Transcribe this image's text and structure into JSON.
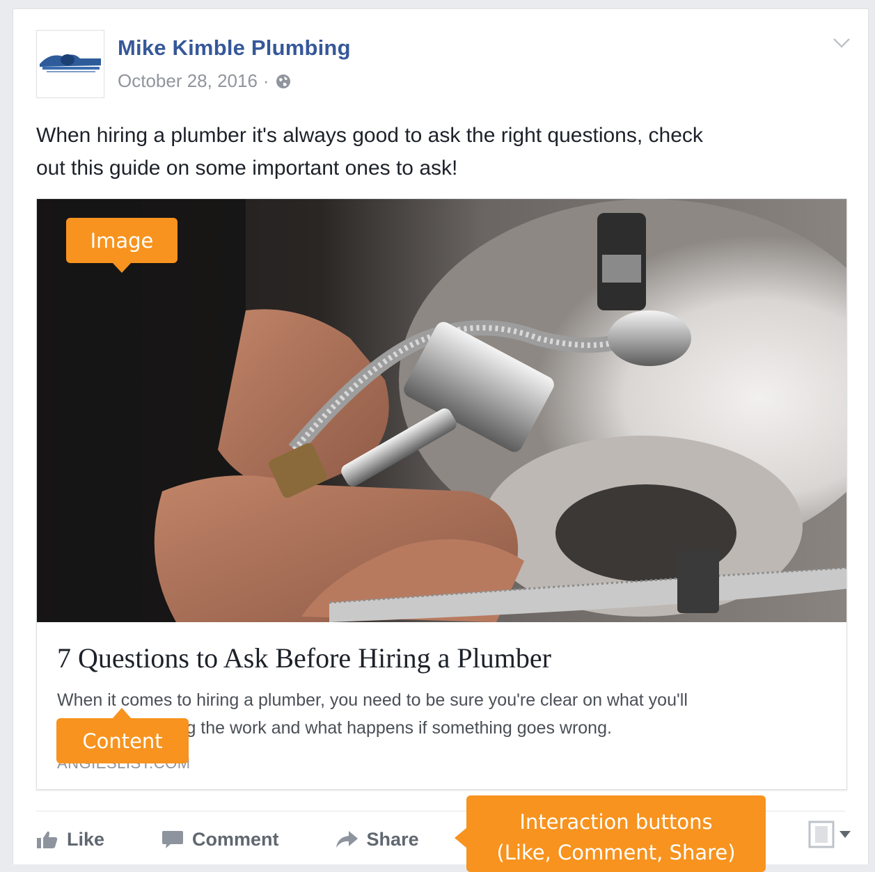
{
  "post": {
    "page_name": "Mike Kimble Plumbing",
    "date": "October 28, 2016",
    "separator": "·",
    "text_line1": "When hiring a plumber it's always good to ask the right questions, check",
    "text_line2": "out this guide on some important ones to ask!"
  },
  "link": {
    "title": "7 Questions to Ask Before Hiring a Plumber",
    "description_line1": "When it comes to hiring a plumber, you need to be sure you're clear on what you'll",
    "description_line2": "have, who's doing the work and what happens if something goes wrong.",
    "source": "ANGIESLIST.COM"
  },
  "actions": {
    "like": "Like",
    "comment": "Comment",
    "share": "Share"
  },
  "annotations": {
    "image": "Image",
    "content": "Content",
    "interaction_line1": "Interaction buttons",
    "interaction_line2": "(Like, Comment, Share)"
  },
  "icons": {
    "avatar": "company-logo",
    "meta": "globe-icon",
    "menu": "chevron-down-icon",
    "like": "thumbs-up-icon",
    "comment": "comment-bubble-icon",
    "share": "share-arrow-icon",
    "save": "bookmark-icon"
  },
  "colors": {
    "link_blue": "#365899",
    "callout": "#f7931e",
    "meta_gray": "#90949c",
    "action_gray": "#606770"
  }
}
